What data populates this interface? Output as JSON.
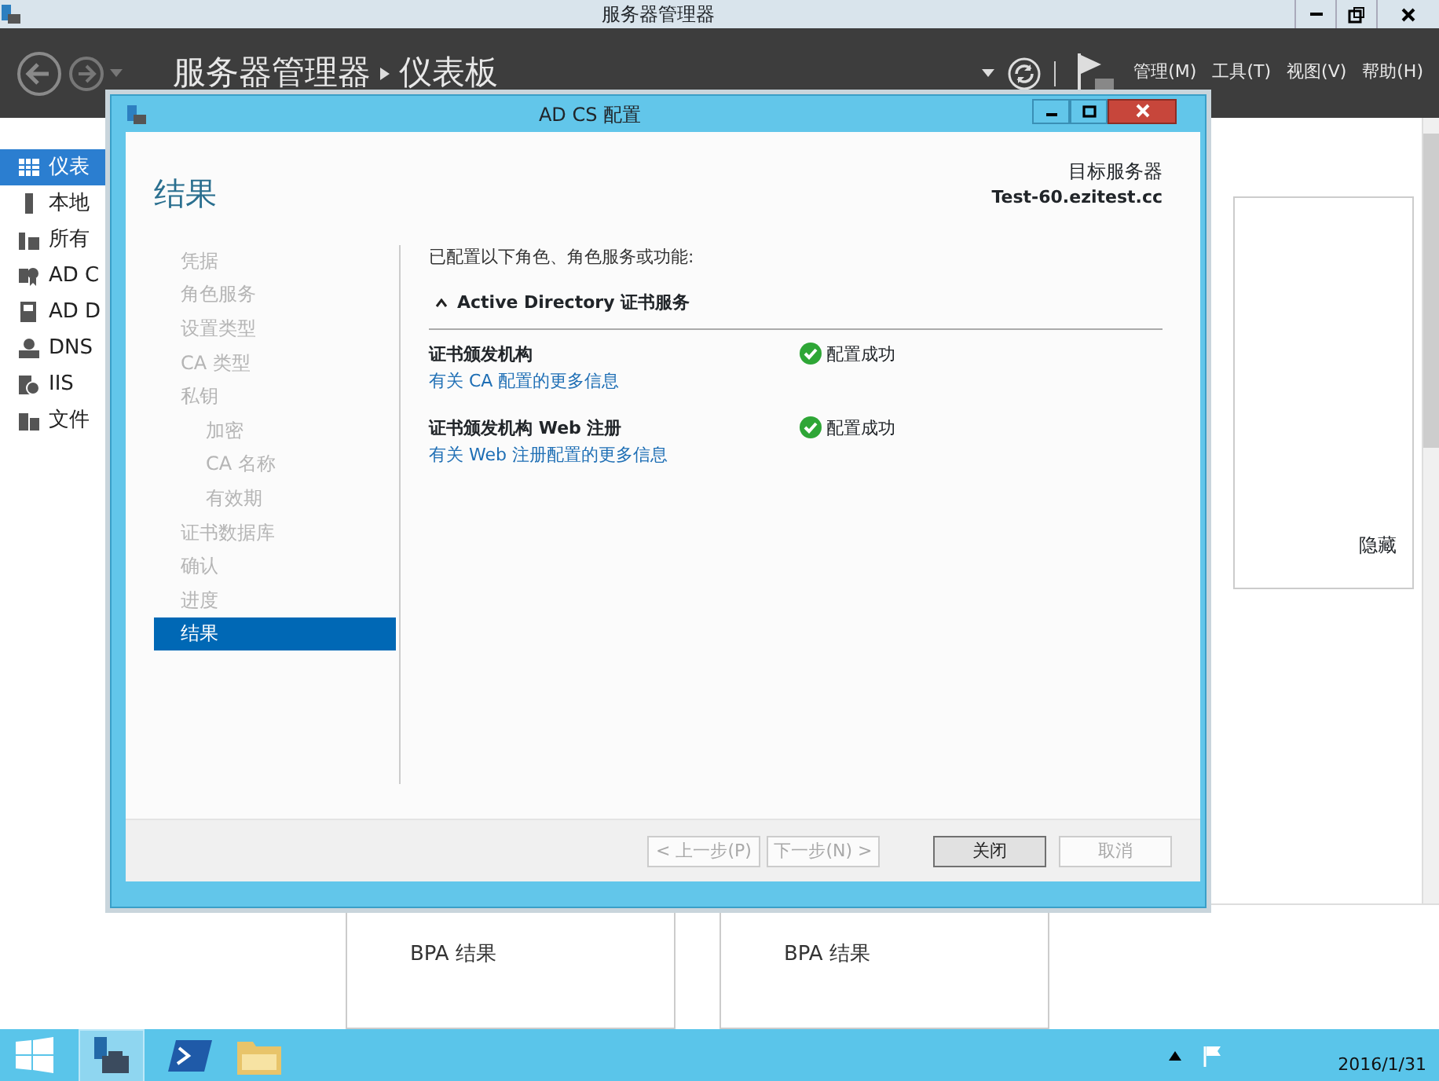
{
  "app": {
    "title": "服务器管理器",
    "breadcrumb": [
      "服务器管理器",
      "仪表板"
    ],
    "menus": [
      "管理(M)",
      "工具(T)",
      "视图(V)",
      "帮助(H)"
    ],
    "sidebar": [
      {
        "label": "仪表",
        "selected": true
      },
      {
        "label": "本地",
        "selected": false
      },
      {
        "label": "所有",
        "selected": false
      },
      {
        "label": "AD C",
        "selected": false
      },
      {
        "label": "AD D",
        "selected": false
      },
      {
        "label": "DNS",
        "selected": false
      },
      {
        "label": "IIS",
        "selected": false
      },
      {
        "label": "文件",
        "selected": false
      }
    ],
    "hide_label": "隐藏",
    "tiles": [
      {
        "label": "BPA 结果"
      },
      {
        "label": "BPA 结果"
      }
    ]
  },
  "dialog": {
    "title": "AD CS 配置",
    "heading": "结果",
    "target_label": "目标服务器",
    "target_server": "Test-60.ezitest.cc",
    "steps": [
      {
        "label": "凭据",
        "selected": false
      },
      {
        "label": "角色服务",
        "selected": false
      },
      {
        "label": "设置类型",
        "selected": false
      },
      {
        "label": "CA 类型",
        "selected": false
      },
      {
        "label": "私钥",
        "selected": false,
        "children": [
          {
            "label": "加密",
            "selected": false
          },
          {
            "label": "CA 名称",
            "selected": false
          },
          {
            "label": "有效期",
            "selected": false
          }
        ]
      },
      {
        "label": "证书数据库",
        "selected": false
      },
      {
        "label": "确认",
        "selected": false
      },
      {
        "label": "进度",
        "selected": false
      },
      {
        "label": "结果",
        "selected": true
      }
    ],
    "intro": "已配置以下角色、角色服务或功能:",
    "section": {
      "title": "Active Directory 证书服务",
      "expanded": true
    },
    "results": [
      {
        "name": "证书颁发机构",
        "link": "有关 CA 配置的更多信息",
        "status": "配置成功"
      },
      {
        "name": "证书颁发机构 Web 注册",
        "link": "有关 Web 注册配置的更多信息",
        "status": "配置成功"
      }
    ],
    "buttons": [
      {
        "label": "< 上一步(P)",
        "disabled": true
      },
      {
        "label": "下一步(N) >",
        "disabled": true
      },
      {
        "label": "关闭",
        "disabled": false
      },
      {
        "label": "取消",
        "disabled": true
      }
    ]
  },
  "taskbar": {
    "date": "2016/1/31"
  }
}
